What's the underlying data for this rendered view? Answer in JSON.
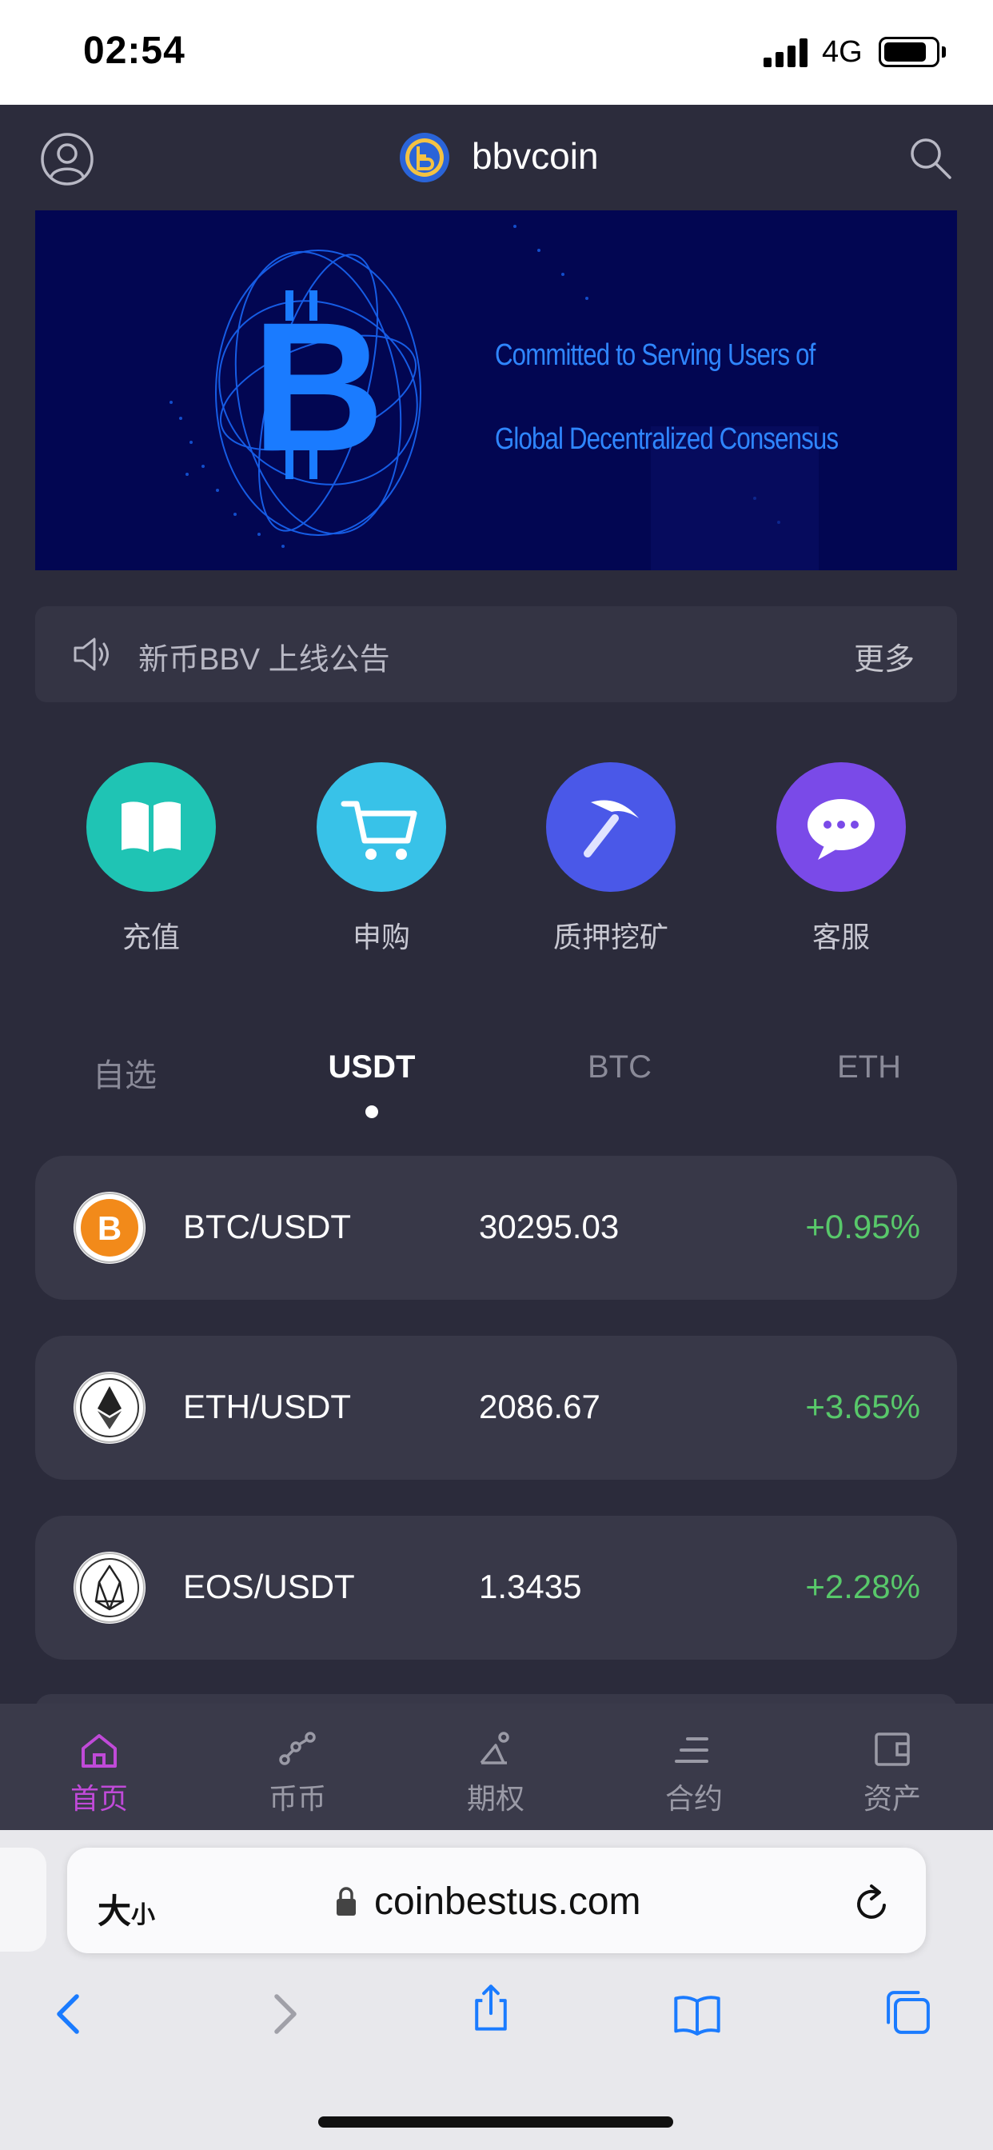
{
  "status_bar": {
    "time": "02:54",
    "network": "4G"
  },
  "header": {
    "title": "bbvcoin"
  },
  "banner": {
    "line1": "Committed to Serving Users of",
    "line2": "Global Decentralized Consensus"
  },
  "notice": {
    "text": "新币BBV 上线公告",
    "more": "更多"
  },
  "quick_actions": [
    {
      "label": "充值",
      "icon": "book-icon",
      "color": "#1fc4b4"
    },
    {
      "label": "申购",
      "icon": "cart-icon",
      "color": "#38c2e8"
    },
    {
      "label": "质押挖矿",
      "icon": "pickaxe-icon",
      "color": "#4a58e8"
    },
    {
      "label": "客服",
      "icon": "chat-icon",
      "color": "#7a4ae8"
    }
  ],
  "market_tabs": [
    {
      "label": "自选",
      "active": false
    },
    {
      "label": "USDT",
      "active": true
    },
    {
      "label": "BTC",
      "active": false
    },
    {
      "label": "ETH",
      "active": false
    }
  ],
  "markets": [
    {
      "pair": "BTC/USDT",
      "price": "30295.03",
      "change": "+0.95%",
      "icon": "btc-icon"
    },
    {
      "pair": "ETH/USDT",
      "price": "2086.67",
      "change": "+3.65%",
      "icon": "eth-icon"
    },
    {
      "pair": "EOS/USDT",
      "price": "1.3435",
      "change": "+2.28%",
      "icon": "eos-icon"
    }
  ],
  "bottom_nav": [
    {
      "label": "首页",
      "icon": "home-icon",
      "active": true
    },
    {
      "label": "币币",
      "icon": "exchange-icon",
      "active": false
    },
    {
      "label": "期权",
      "icon": "options-icon",
      "active": false
    },
    {
      "label": "合约",
      "icon": "contract-icon",
      "active": false
    },
    {
      "label": "资产",
      "icon": "wallet-icon",
      "active": false
    }
  ],
  "browser": {
    "text_size_label": "大",
    "text_size_small": "小",
    "url": "coinbestus.com"
  },
  "colors": {
    "positive": "#58c86a",
    "active_nav": "#c04ad8",
    "background": "#2b2b3b"
  }
}
